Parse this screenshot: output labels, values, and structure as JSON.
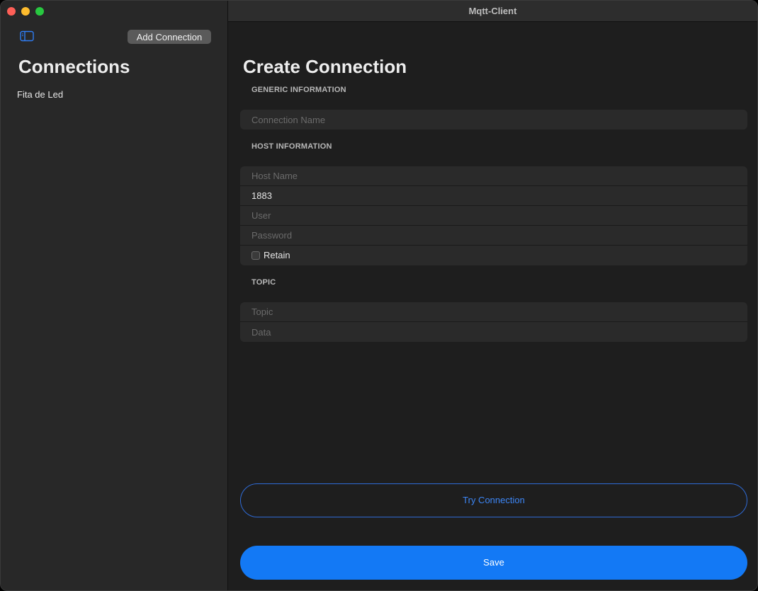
{
  "window": {
    "title": "Mqtt-Client"
  },
  "sidebar": {
    "add_connection_label": "Add Connection",
    "title": "Connections",
    "items": [
      {
        "label": "Fita de Led"
      }
    ]
  },
  "main": {
    "title": "Create Connection",
    "generic": {
      "label": "GENERIC INFORMATION",
      "connection_name_placeholder": "Connection Name",
      "connection_name_value": ""
    },
    "host": {
      "label": "HOST INFORMATION",
      "host_name_placeholder": "Host Name",
      "host_name_value": "",
      "port_value": "1883",
      "user_placeholder": "User",
      "password_placeholder": "Password",
      "retain_label": "Retain",
      "retain_checked": false
    },
    "topic": {
      "label": "TOPIC",
      "topic_placeholder": "Topic",
      "data_placeholder": "Data"
    },
    "try_connection_label": "Try Connection",
    "save_label": "Save"
  },
  "colors": {
    "accent": "#1379f5",
    "outline_button": "#2f6bd6",
    "background": "#1e1e1e",
    "sidebar": "#282828"
  },
  "icons": {
    "sidebar_toggle": "sidebar-toggle-icon"
  }
}
